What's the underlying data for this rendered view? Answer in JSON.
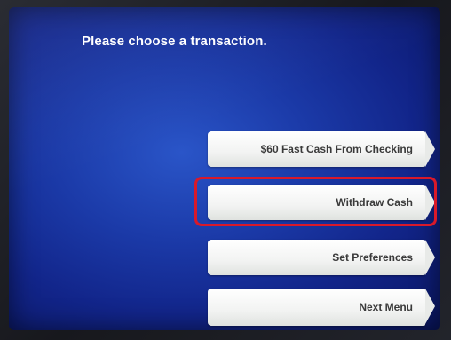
{
  "screen": {
    "prompt": "Please choose a transaction."
  },
  "menu": {
    "items": [
      {
        "label": "$60 Fast Cash From Checking"
      },
      {
        "label": "Withdraw Cash"
      },
      {
        "label": "Set Preferences"
      },
      {
        "label": "Next Menu"
      }
    ],
    "highlighted_item": "Withdraw Cash"
  },
  "colors": {
    "screen_background": "#1b3aa8",
    "button_background": "#f2f3f2",
    "button_text": "#3a3a3a",
    "highlight_outline": "#d9192a"
  },
  "icons": {
    "button_arrow": "chevron-right-icon"
  }
}
